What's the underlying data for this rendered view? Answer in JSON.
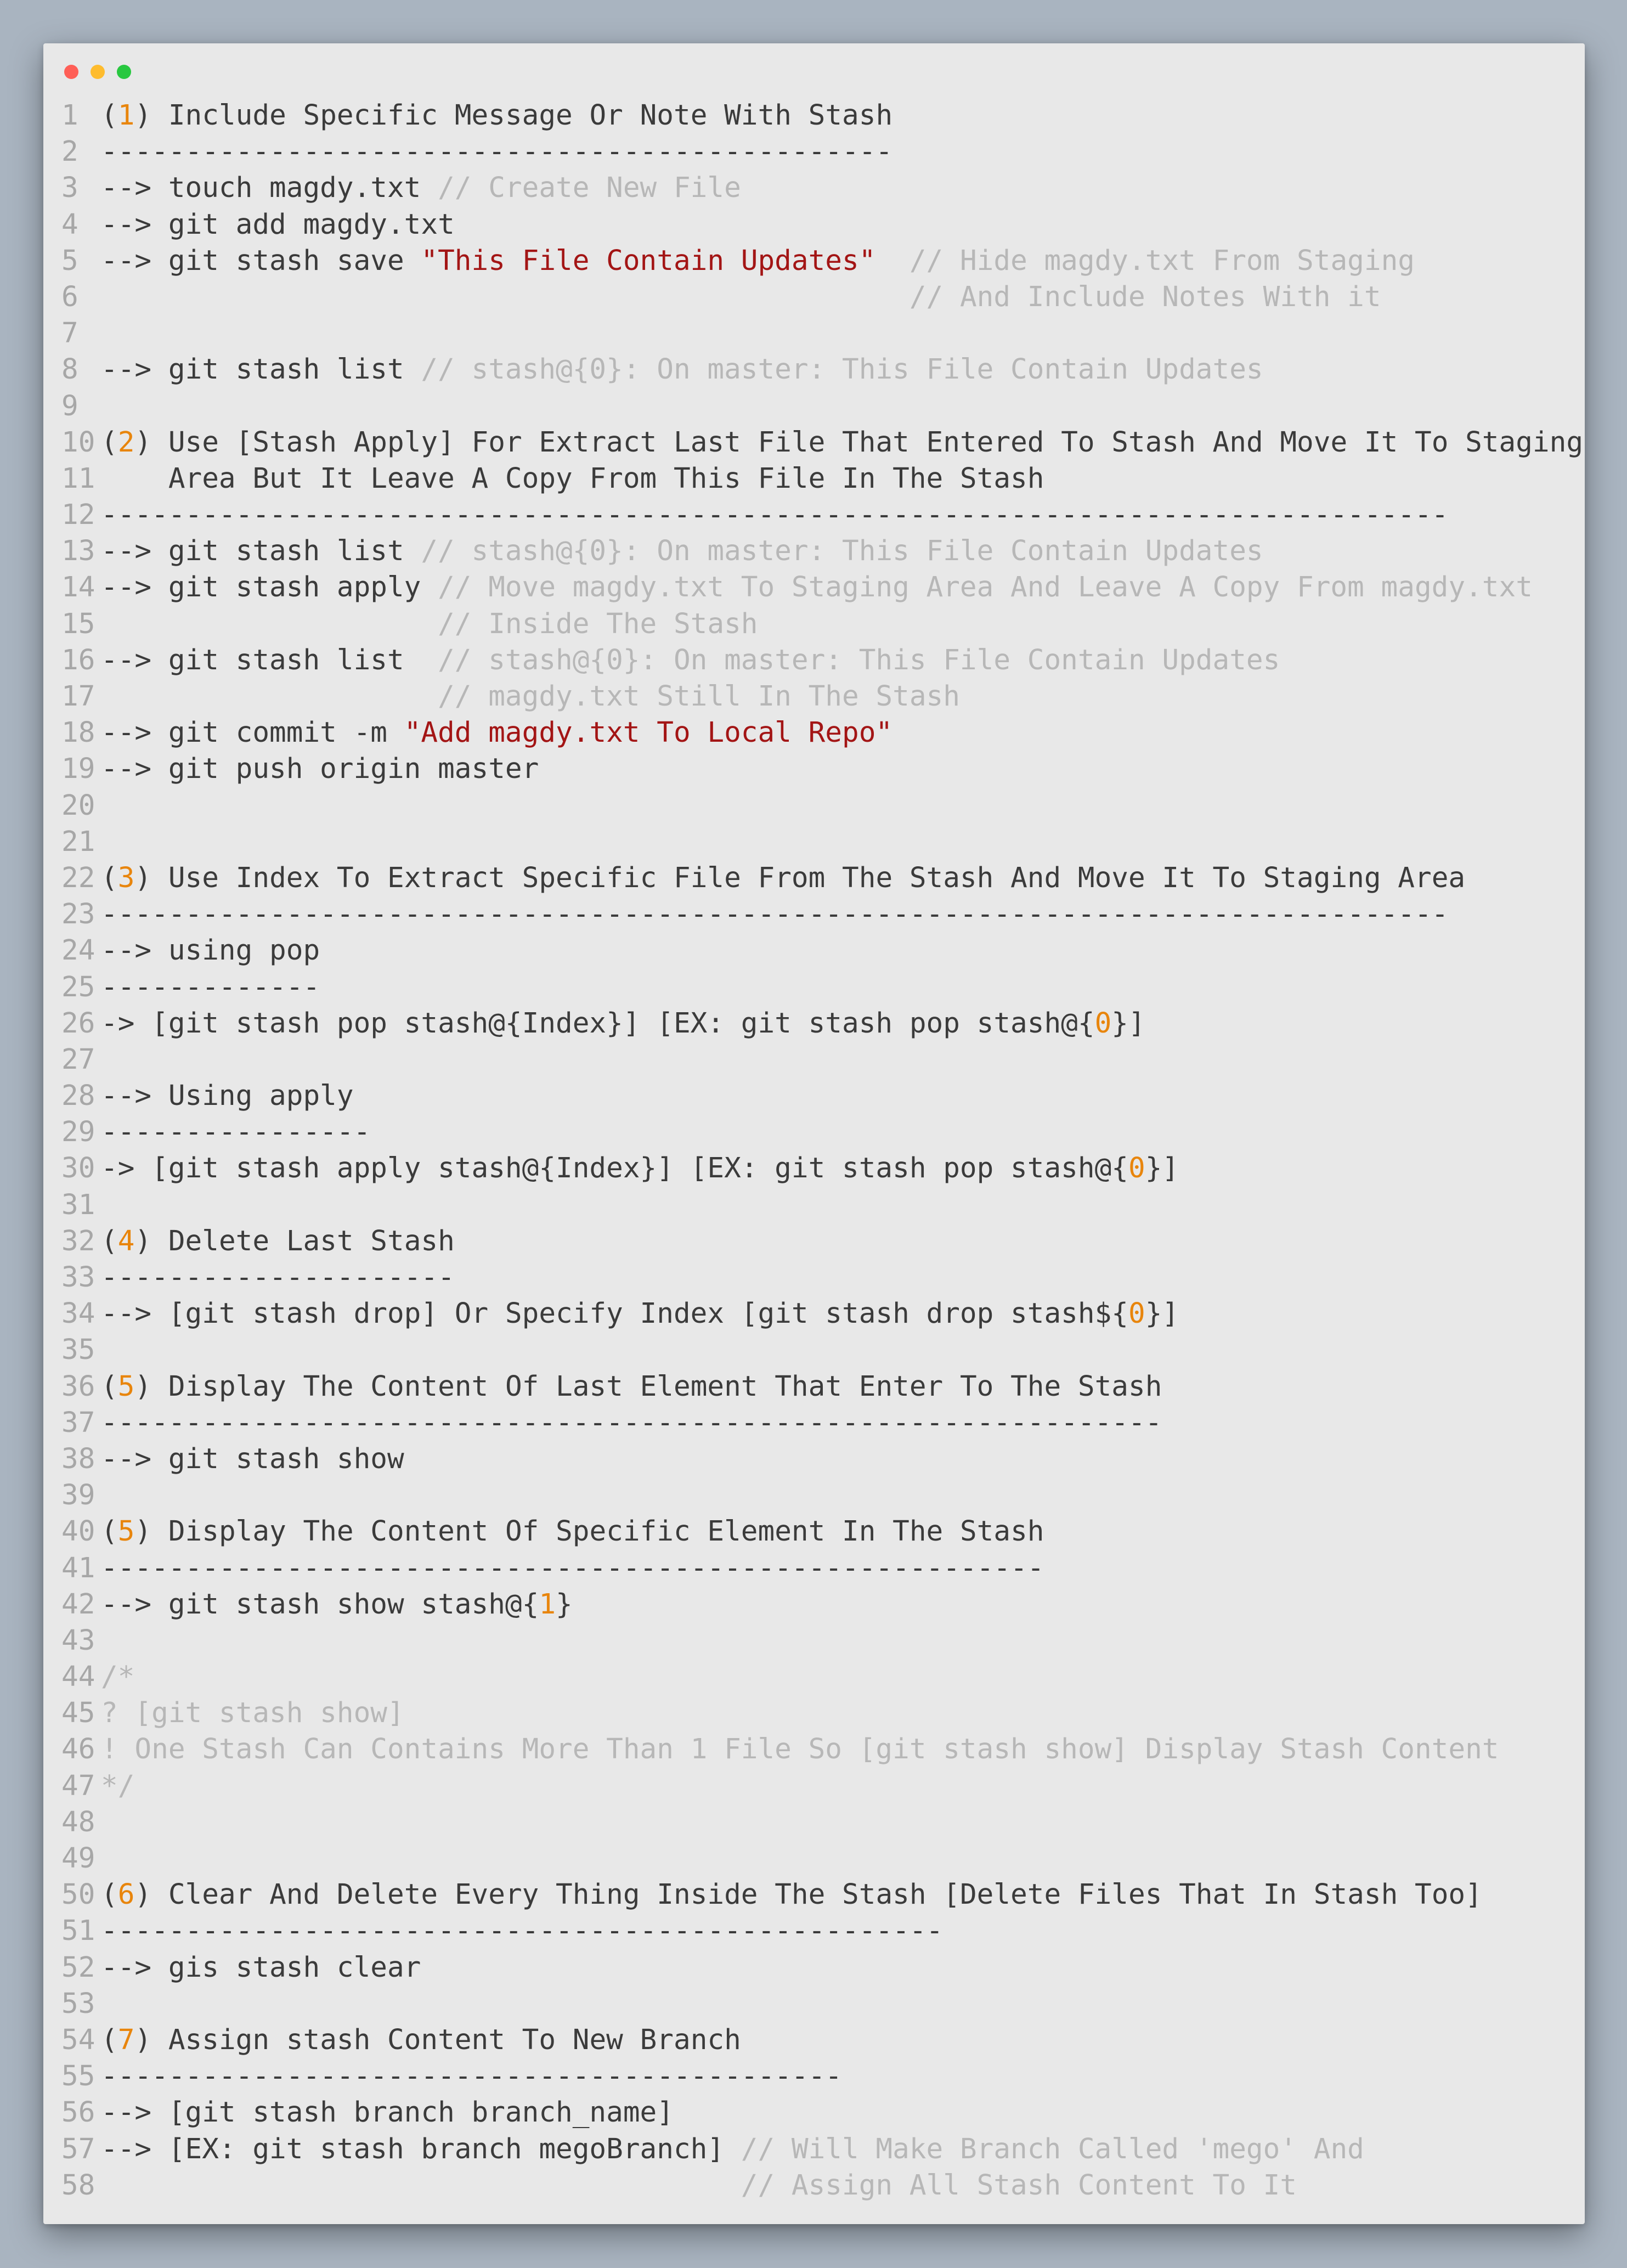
{
  "colors": {
    "background": "#a9b4c0",
    "editor_bg": "#e8e8e8",
    "text": "#3b3b3b",
    "number": "#e8850c",
    "string": "#a31515",
    "comment": "#b7b7b7",
    "line_number": "#a7a7a7"
  },
  "window_controls": [
    "close-dot",
    "minimize-dot",
    "zoom-dot"
  ],
  "lines": [
    [
      [
        "(",
        ""
      ],
      [
        "1",
        "num"
      ],
      [
        ") Include Specific Message Or Note With Stash",
        ""
      ]
    ],
    [
      [
        "-----------------------------------------------",
        ""
      ]
    ],
    [
      [
        "--> touch magdy.txt ",
        ""
      ],
      [
        "// Create New File",
        "cmt"
      ]
    ],
    [
      [
        "--> git add magdy.txt",
        ""
      ]
    ],
    [
      [
        "--> git stash save ",
        ""
      ],
      [
        "\"This File Contain Updates\"",
        "str"
      ],
      [
        "  ",
        ""
      ],
      [
        "// Hide magdy.txt From Staging",
        "cmt"
      ]
    ],
    [
      [
        "                                                ",
        ""
      ],
      [
        "// And Include Notes With it",
        "cmt"
      ]
    ],
    [],
    [
      [
        "--> git stash list ",
        ""
      ],
      [
        "// stash@{0}: On master: This File Contain Updates",
        "cmt"
      ]
    ],
    [],
    [
      [
        "(",
        ""
      ],
      [
        "2",
        "num"
      ],
      [
        ") Use [Stash Apply] For Extract Last File That Entered To Stash And Move It To Staging",
        ""
      ]
    ],
    [
      [
        "    Area But It Leave A Copy From This File In The Stash",
        ""
      ]
    ],
    [
      [
        "--------------------------------------------------------------------------------",
        ""
      ]
    ],
    [
      [
        "--> git stash list ",
        ""
      ],
      [
        "// stash@{0}: On master: This File Contain Updates",
        "cmt"
      ]
    ],
    [
      [
        "--> git stash apply ",
        ""
      ],
      [
        "// Move magdy.txt To Staging Area And Leave A Copy From magdy.txt",
        "cmt"
      ]
    ],
    [
      [
        "                    ",
        ""
      ],
      [
        "// Inside The Stash",
        "cmt"
      ]
    ],
    [
      [
        "--> git stash list  ",
        ""
      ],
      [
        "// stash@{0}: On master: This File Contain Updates",
        "cmt"
      ]
    ],
    [
      [
        "                    ",
        ""
      ],
      [
        "// magdy.txt Still In The Stash",
        "cmt"
      ]
    ],
    [
      [
        "--> git commit -m ",
        ""
      ],
      [
        "\"Add magdy.txt To Local Repo\"",
        "str"
      ]
    ],
    [
      [
        "--> git push origin master",
        ""
      ]
    ],
    [],
    [],
    [
      [
        "(",
        ""
      ],
      [
        "3",
        "num"
      ],
      [
        ") Use Index To Extract Specific File From The Stash And Move It To Staging Area",
        ""
      ]
    ],
    [
      [
        "--------------------------------------------------------------------------------",
        ""
      ]
    ],
    [
      [
        "--> using pop",
        ""
      ]
    ],
    [
      [
        "-------------",
        ""
      ]
    ],
    [
      [
        "-> [git stash pop stash@{Index}] [EX: git stash pop stash@{",
        ""
      ],
      [
        "0",
        "num"
      ],
      [
        "}]",
        ""
      ]
    ],
    [],
    [
      [
        "--> Using apply",
        ""
      ]
    ],
    [
      [
        "----------------",
        ""
      ]
    ],
    [
      [
        "-> [git stash apply stash@{Index}] [EX: git stash pop stash@{",
        ""
      ],
      [
        "0",
        "num"
      ],
      [
        "}]",
        ""
      ]
    ],
    [],
    [
      [
        "(",
        ""
      ],
      [
        "4",
        "num"
      ],
      [
        ") Delete Last Stash",
        ""
      ]
    ],
    [
      [
        "---------------------",
        ""
      ]
    ],
    [
      [
        "--> [git stash drop] Or Specify Index [git stash drop stash${",
        ""
      ],
      [
        "0",
        "num"
      ],
      [
        "}]",
        ""
      ]
    ],
    [],
    [
      [
        "(",
        ""
      ],
      [
        "5",
        "num"
      ],
      [
        ") Display The Content Of Last Element That Enter To The Stash",
        ""
      ]
    ],
    [
      [
        "---------------------------------------------------------------",
        ""
      ]
    ],
    [
      [
        "--> git stash show",
        ""
      ]
    ],
    [],
    [
      [
        "(",
        ""
      ],
      [
        "5",
        "num"
      ],
      [
        ") Display The Content Of Specific Element In The Stash",
        ""
      ]
    ],
    [
      [
        "--------------------------------------------------------",
        ""
      ]
    ],
    [
      [
        "--> git stash show stash@{",
        ""
      ],
      [
        "1",
        "num"
      ],
      [
        "}",
        ""
      ]
    ],
    [],
    [
      [
        "/*",
        "cmt"
      ]
    ],
    [
      [
        "? [git stash show]",
        "cmt"
      ]
    ],
    [
      [
        "! One Stash Can Contains More Than 1 File So [git stash show] Display Stash Content",
        "cmt"
      ]
    ],
    [
      [
        "*/",
        "cmt"
      ]
    ],
    [],
    [],
    [
      [
        "(",
        ""
      ],
      [
        "6",
        "num"
      ],
      [
        ") Clear And Delete Every Thing Inside The Stash [Delete Files That In Stash Too]",
        ""
      ]
    ],
    [
      [
        "--------------------------------------------------",
        ""
      ]
    ],
    [
      [
        "--> gis stash clear",
        ""
      ]
    ],
    [],
    [
      [
        "(",
        ""
      ],
      [
        "7",
        "num"
      ],
      [
        ") Assign stash Content To New Branch",
        ""
      ]
    ],
    [
      [
        "--------------------------------------------",
        ""
      ]
    ],
    [
      [
        "--> [git stash branch branch_name]",
        ""
      ]
    ],
    [
      [
        "--> [EX: git stash branch megoBranch] ",
        ""
      ],
      [
        "// Will Make Branch Called 'mego' And",
        "cmt"
      ]
    ],
    [
      [
        "                                      ",
        ""
      ],
      [
        "// Assign All Stash Content To It",
        "cmt"
      ]
    ]
  ]
}
